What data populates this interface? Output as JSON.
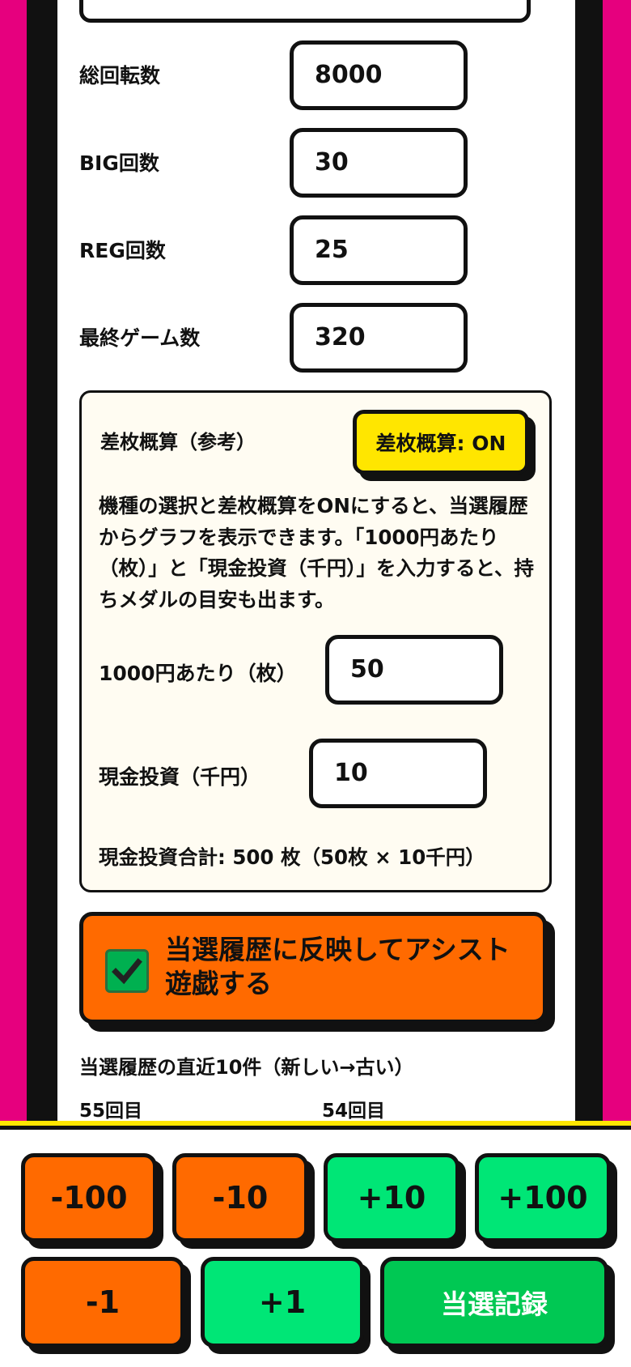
{
  "form": {
    "total_spins_label": "総回転数",
    "total_spins_value": "8000",
    "big_label": "BIG回数",
    "big_value": "30",
    "reg_label": "REG回数",
    "reg_value": "25",
    "final_games_label": "最終ゲーム数",
    "final_games_value": "320"
  },
  "calc": {
    "title": "差枚概算（参考）",
    "toggle_label": "差枚概算: ON",
    "description": "機種の選択と差枚概算をONにすると、当選履歴からグラフを表示できます。「1000円あたり（枚）」と「現金投資（千円）」を入力すると、持ちメダルの目安も出ます。",
    "per1000_label": "1000円あたり（枚）",
    "per1000_value": "50",
    "cash_label": "現金投資（千円）",
    "cash_value": "10",
    "total_text": "現金投資合計: 500 枚（50枚 × 10千円）"
  },
  "assist": {
    "checked": true,
    "line1": "当選履歴に反映してアシスト",
    "line2": "遊戯する"
  },
  "history": {
    "heading": "当選履歴の直近10件（新しい→古い）",
    "items": [
      "55回目",
      "54回目"
    ]
  },
  "keypad": {
    "minus100": "-100",
    "minus10": "-10",
    "plus10": "+10",
    "plus100": "+100",
    "minus1": "-1",
    "plus1": "+1",
    "record": "当選記録"
  },
  "colors": {
    "background": "#e6007e",
    "orange": "#ff6a00",
    "green": "#00e676",
    "dark_green": "#00c853",
    "yellow": "#ffe600"
  }
}
